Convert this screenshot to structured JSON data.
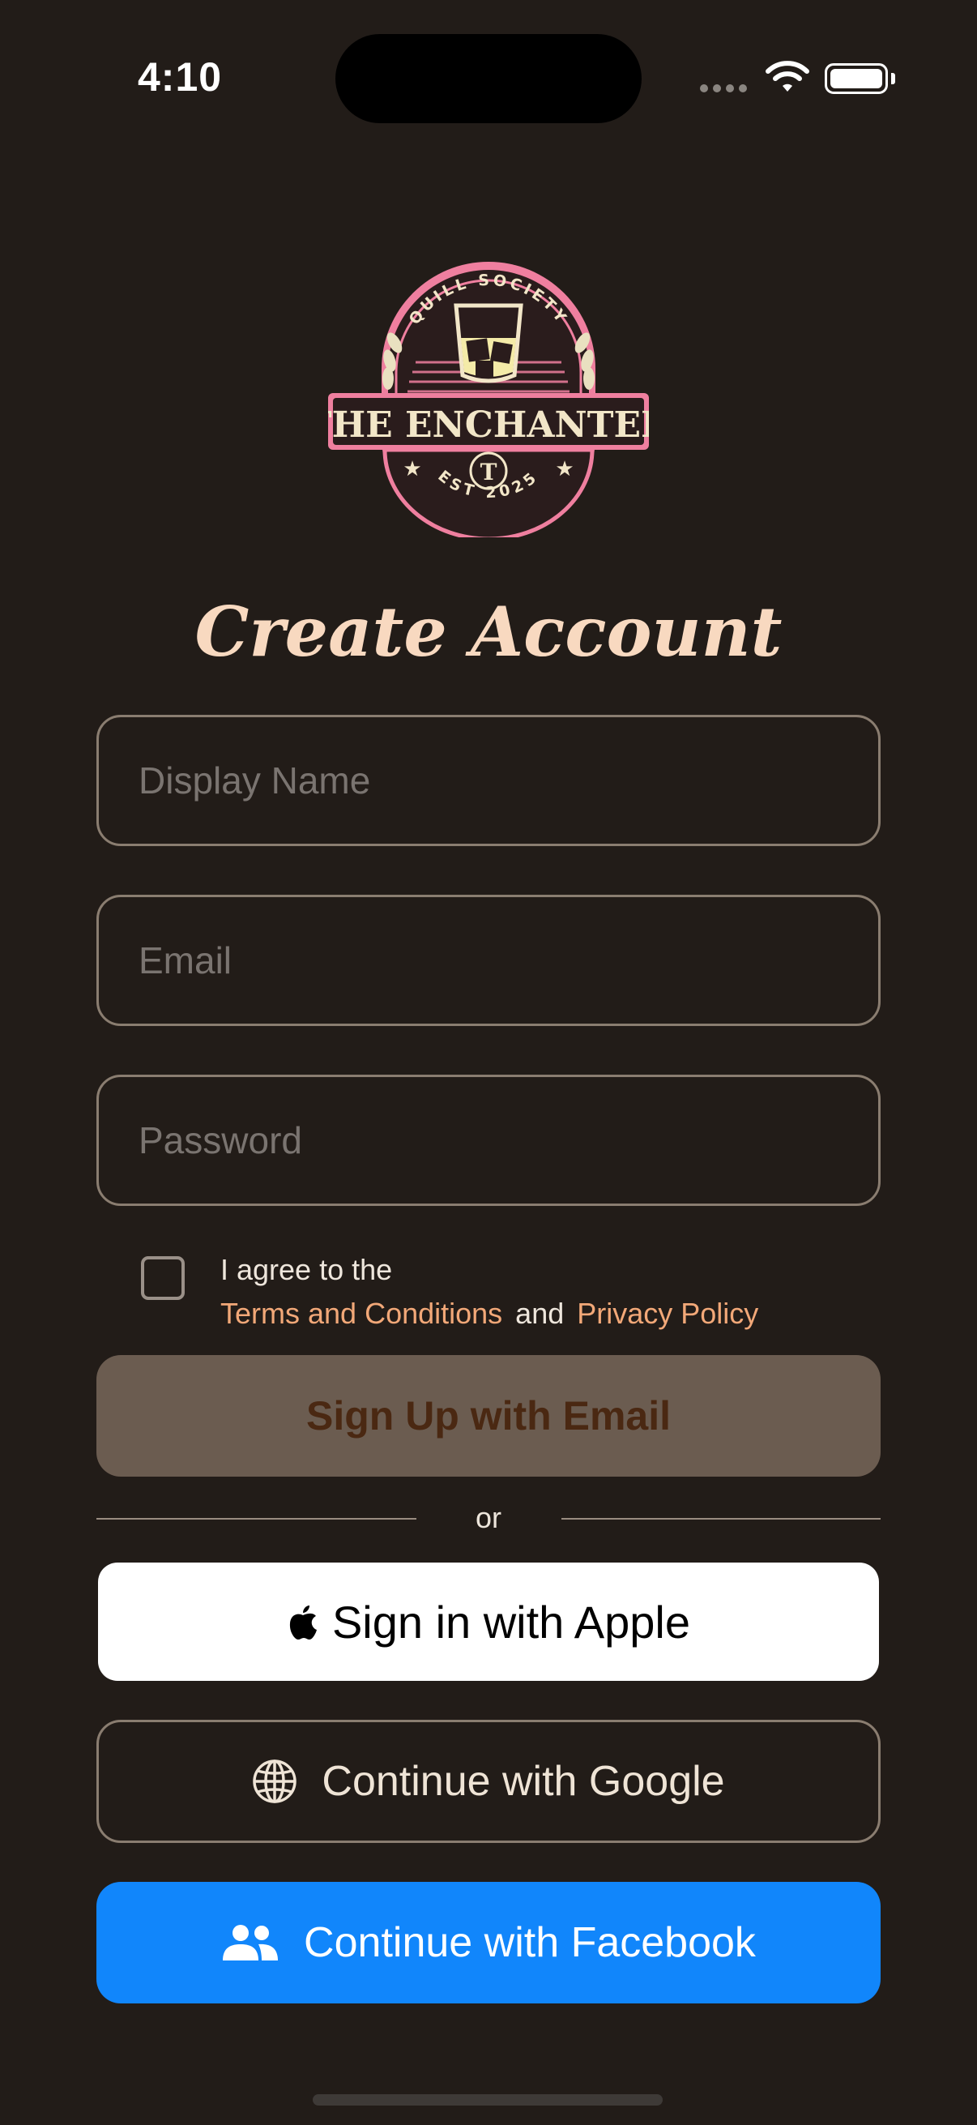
{
  "status_bar": {
    "time": "4:10"
  },
  "logo": {
    "ring_text": "QUILL SOCIETY",
    "title": "THE ENCHANTED",
    "bottom_text": "EST 2025",
    "monogram": "T"
  },
  "heading": "Create Account",
  "form": {
    "display_name_placeholder": "Display Name",
    "email_placeholder": "Email",
    "password_placeholder": "Password"
  },
  "agreement": {
    "checked": false,
    "line1": "I agree to the",
    "terms_link": "Terms and Conditions",
    "and": "and",
    "privacy_link": "Privacy Policy"
  },
  "buttons": {
    "email_signup": "Sign Up with Email",
    "divider": "or",
    "apple": "Sign in with Apple",
    "google": "Continue with Google",
    "facebook": "Continue with Facebook"
  },
  "icons": {
    "apple": "apple-logo-icon",
    "google": "globe-icon",
    "facebook": "people-icon"
  },
  "colors": {
    "background": "#221c18",
    "accent_link": "#f2a878",
    "email_button": "#6b5c50",
    "facebook_button": "#1186fb",
    "logo_pink": "#ef7f9f"
  }
}
